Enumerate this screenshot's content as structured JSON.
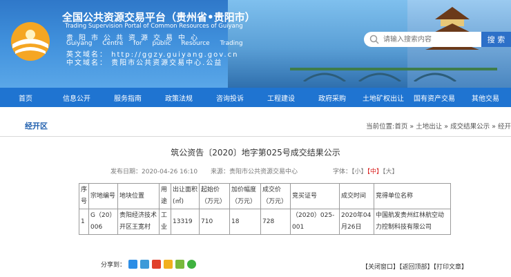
{
  "header": {
    "title_cn": "全国公共资源交易平台（贵州省•贵阳市）",
    "title_en": "Trading Supervision Portal of Common Resources of Guiyang",
    "org_cn": "贵阳市公共资源交易中心",
    "org_en": "Guiyang Centre for public Resource Trading",
    "domain_en": "英文域名：  http://ggzy.guiyang.gov.cn",
    "domain_cn": "中文域名：  贵阳市公共资源交易中心.公益"
  },
  "search": {
    "placeholder": "请输入搜索内容",
    "button_label": "搜 索"
  },
  "nav": {
    "items": [
      "首页",
      "信息公开",
      "服务指南",
      "政策法规",
      "咨询投诉",
      "工程建设",
      "政府采购",
      "土地矿权出让",
      "国有资产交易",
      "其他交易"
    ]
  },
  "breadcrumb": {
    "zone": "经开区",
    "prefix": "当前位置:",
    "items": [
      "首页",
      "土地出让",
      "成交结果公示",
      "经开"
    ],
    "sep": " » "
  },
  "article": {
    "title": "筑公资告〔2020〕地字第025号成交结果公示",
    "date": "发布日期：2020-04-26 16:10",
    "source": "来源：贵阳市公共资源交易中心",
    "font_label": "字体：",
    "font_small": "【小】",
    "font_mid": "【中】",
    "font_large": "【大】"
  },
  "table": {
    "headers": [
      "序号",
      "宗地编号",
      "地块位置",
      "用途",
      "出让面积(㎡)",
      "起始价（万元）",
      "加价幅度（万元）",
      "成交价（万元）",
      "竞买证号",
      "成交时间",
      "竞得单位名称"
    ],
    "row": [
      "1",
      "G（20）006",
      "贵阳经济技术开区王宽村",
      "工业",
      "13319",
      "710",
      "18",
      "728",
      "（2020）025-001",
      "2020年04月26日",
      "中国航发贵州红林航空动力控制科技有限公司"
    ]
  },
  "share": {
    "label": "分享到："
  },
  "bottom": {
    "close": "【关闭窗口】",
    "top": "【返回顶部】",
    "print": "【打印文章】"
  }
}
